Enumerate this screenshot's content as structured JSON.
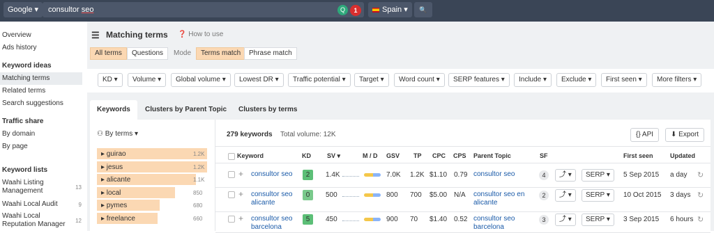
{
  "topbar": {
    "engine": "Google ▾",
    "query_plain": "consultor ",
    "query_underlined": "seo",
    "ext_icon": "Q",
    "badge_count": "1",
    "country": "Spain ▾",
    "search_icon": "🔍"
  },
  "sidebar": {
    "overview": "Overview",
    "ads_history": "Ads history",
    "keyword_ideas_head": "Keyword ideas",
    "matching_terms": "Matching terms",
    "related_terms": "Related terms",
    "search_suggestions": "Search suggestions",
    "traffic_share_head": "Traffic share",
    "by_domain": "By domain",
    "by_page": "By page",
    "keyword_lists_head": "Keyword lists",
    "lists": [
      {
        "name": "Waahi Listing Management",
        "count": "13"
      },
      {
        "name": "Waahi Local Audit",
        "count": "9"
      },
      {
        "name": "Waahi Local Reputation Manager",
        "count": "12"
      }
    ]
  },
  "header": {
    "title": "Matching terms",
    "howto": "How to use",
    "seg_all": "All terms",
    "seg_questions": "Questions",
    "mode_label": "Mode",
    "seg_terms": "Terms match",
    "seg_phrase": "Phrase match"
  },
  "filters": [
    "KD ▾",
    "Volume ▾",
    "Global volume ▾",
    "Lowest DR ▾",
    "Traffic potential ▾",
    "Target ▾",
    "Word count ▾",
    "SERP features ▾",
    "Include ▾",
    "Exclude ▾",
    "First seen ▾",
    "More filters ▾"
  ],
  "tabs": [
    "Keywords",
    "Clusters by Parent Topic",
    "Clusters by terms"
  ],
  "left_panel": {
    "by_terms": "By terms ▾",
    "terms": [
      {
        "term": "guirao",
        "count": "1.2K",
        "fill": 1.0
      },
      {
        "term": "jesus",
        "count": "1.2K",
        "fill": 1.0
      },
      {
        "term": "alicante",
        "count": "1.1K",
        "fill": 0.9
      },
      {
        "term": "local",
        "count": "850",
        "fill": 0.71
      },
      {
        "term": "pymes",
        "count": "680",
        "fill": 0.57
      },
      {
        "term": "freelance",
        "count": "660",
        "fill": 0.55
      }
    ]
  },
  "results": {
    "keyword_count": "279 keywords",
    "total_volume": "Total volume: 12K",
    "api_label": "{} API",
    "export_label": "Export",
    "columns": [
      "Keyword",
      "KD",
      "SV ▾",
      "M / D",
      "GSV",
      "TP",
      "CPC",
      "CPS",
      "Parent Topic",
      "SF",
      "First seen",
      "Updated"
    ],
    "rows": [
      {
        "keyword": "consultor seo",
        "kd": "2",
        "kd_color": "#5cbf77",
        "sv": "1.4K",
        "gsv": "7.0K",
        "tp": "1.2K",
        "cpc": "$1.10",
        "cps": "0.79",
        "parent": "consultor seo",
        "sf": "4",
        "serp": "SERP ▾",
        "first_seen": "5 Sep 2015",
        "updated": "a day"
      },
      {
        "keyword": "consultor seo alicante",
        "kd": "0",
        "kd_color": "#79c98b",
        "sv": "500",
        "gsv": "800",
        "tp": "700",
        "cpc": "$5.00",
        "cps": "N/A",
        "parent": "consultor seo en alicante",
        "sf": "2",
        "serp": "SERP ▾",
        "first_seen": "10 Oct 2015",
        "updated": "3 days"
      },
      {
        "keyword": "consultor seo barcelona",
        "kd": "5",
        "kd_color": "#5cbf77",
        "sv": "450",
        "gsv": "900",
        "tp": "70",
        "cpc": "$1.40",
        "cps": "0.52",
        "parent": "consultor seo barcelona",
        "sf": "3",
        "serp": "SERP ▾",
        "first_seen": "3 Sep 2015",
        "updated": "6 hours"
      }
    ]
  },
  "colors": {
    "topbar": "#3a4556",
    "accent_orange": "#fbd8b3",
    "link": "#1a5aa8"
  }
}
